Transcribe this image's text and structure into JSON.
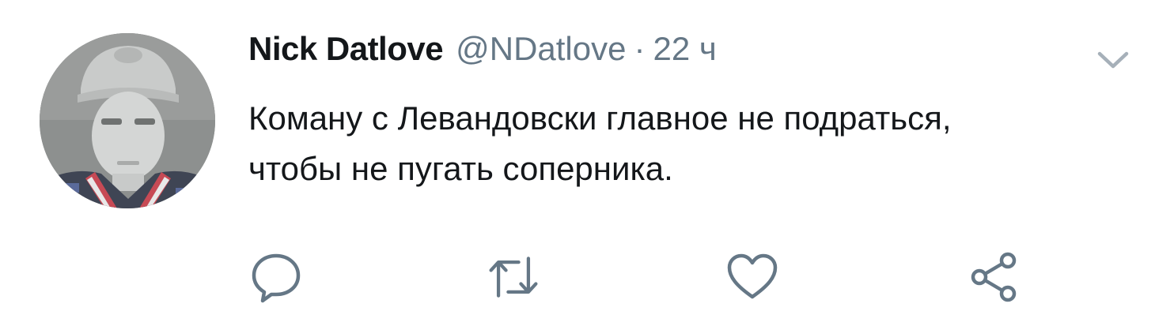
{
  "tweet": {
    "author": {
      "display_name": "Nick Datlove",
      "handle": "@NDatlove"
    },
    "separator": "·",
    "time": "22 ч",
    "text": "Коману с Левандовски главное не подраться,\nчтобы не пугать соперника."
  },
  "icons": {
    "menu": "chevron-down-icon",
    "reply": "reply-icon",
    "retweet": "retweet-icon",
    "like": "heart-icon",
    "share": "share-icon"
  },
  "colors": {
    "text_primary": "#14171a",
    "text_secondary": "#657786",
    "icon": "#657786",
    "background": "#ffffff"
  }
}
